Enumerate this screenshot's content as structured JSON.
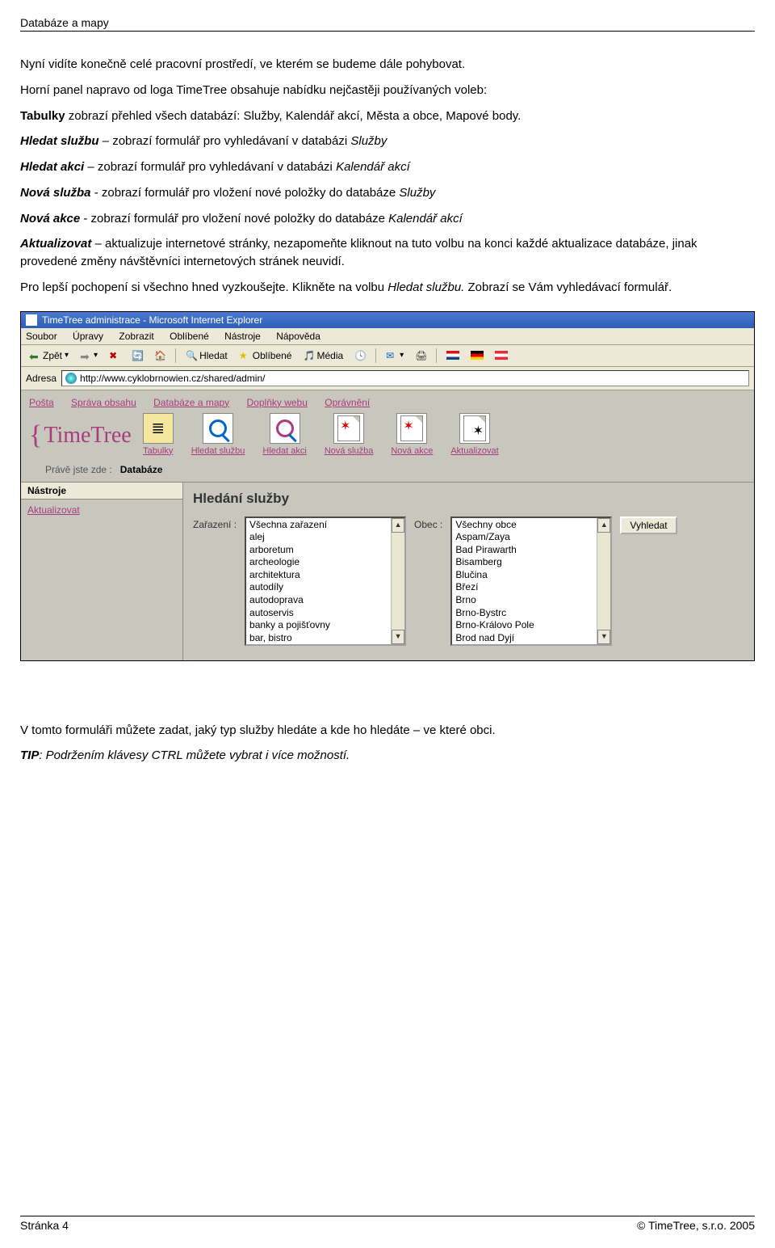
{
  "doc_header": "Databáze a mapy",
  "para1": "Nyní  vidíte konečně celé pracovní prostředí, ve kterém se budeme dále pohybovat.",
  "para2_a": "Horní panel napravo od loga TimeTree obsahuje nabídku nejčastěji používaných voleb:",
  "para2_b1": "Tabulky",
  "para2_b2": " zobrazí přehled všech databází: Služby, Kalendář akcí, Města a obce, Mapové body.",
  "line3_a": "Hledat službu",
  "line3_b": " – zobrazí formulář pro vyhledávaní v databázi ",
  "line3_c": "Služby",
  "line4_a": "Hledat akci",
  "line4_b": " – zobrazí formulář pro vyhledávaní v databázi  ",
  "line4_c": "Kalendář akcí",
  "line5_a": "Nová služba",
  "line5_b": " - zobrazí formulář pro  vložení nové  položky do databáze  ",
  "line5_c": "Služby",
  "line6_a": "Nová akce",
  "line6_b": " - zobrazí formulář pro  vložení nové  položky do databáze  ",
  "line6_c": "Kalendář akcí",
  "line7_a": "Aktualizovat",
  "line7_b": " – aktualizuje internetové stránky, nezapomeňte kliknout na tuto volbu na konci každé aktualizace databáze, jinak provedené změny návštěvníci internetových stránek neuvidí.",
  "para8_a": "Pro lepší pochopení si všechno hned vyzkoušejte. Klikněte na  volbu ",
  "para8_b": "Hledat službu.",
  "para8_c": " Zobrazí se Vám vyhledávací formulář.",
  "para9": "V tomto formuláři můžete zadat, jaký typ služby hledáte a kde ho hledáte – ve které obci.",
  "tip_label": "TIP",
  "tip_text": ": Podržením klávesy CTRL můžete vybrat i více možností.",
  "browser": {
    "title": "TimeTree administrace - Microsoft Internet Explorer",
    "menu": [
      "Soubor",
      "Úpravy",
      "Zobrazit",
      "Oblíbené",
      "Nástroje",
      "Nápověda"
    ],
    "back": "Zpět",
    "search": "Hledat",
    "fav": "Oblíbené",
    "media": "Média",
    "addr_label": "Adresa",
    "addr_value": "http://www.cyklobrnowien.cz/shared/admin/",
    "tabs": [
      "Pošta",
      "Správa obsahu",
      "Databáze a mapy",
      "Doplňky webu",
      "Oprávnění"
    ],
    "logo": "TimeTree",
    "tool_icons": [
      "Tabulky",
      "Hledat službu",
      "Hledat akci",
      "Nová služba",
      "Nová akce",
      "Aktualizovat"
    ],
    "breadcrumb_label": "Právě jste zde :",
    "breadcrumb_value": "Databáze",
    "sidebar_head": "Nástroje",
    "sidebar_link": "Aktualizovat",
    "main_title": "Hledání služby",
    "filter1_label": "Zařazení :",
    "filter2_label": "Obec :",
    "search_btn": "Vyhledat",
    "list1": [
      "Všechna zařazení",
      "alej",
      "arboretum",
      "archeologie",
      "architektura",
      "autodíly",
      "autodoprava",
      "autoservis",
      "banky a pojišťovny",
      "bar, bistro"
    ],
    "list2": [
      "Všechny obce",
      "Aspam/Zaya",
      "Bad Pirawarth",
      "Bisamberg",
      "Blučina",
      "Březí",
      "Brno",
      "Brno-Bystrc",
      "Brno-Královo Pole",
      "Brod nad Dyjí"
    ]
  },
  "footer": {
    "left": "Stránka 4",
    "right": "© TimeTree, s.r.o. 2005"
  }
}
